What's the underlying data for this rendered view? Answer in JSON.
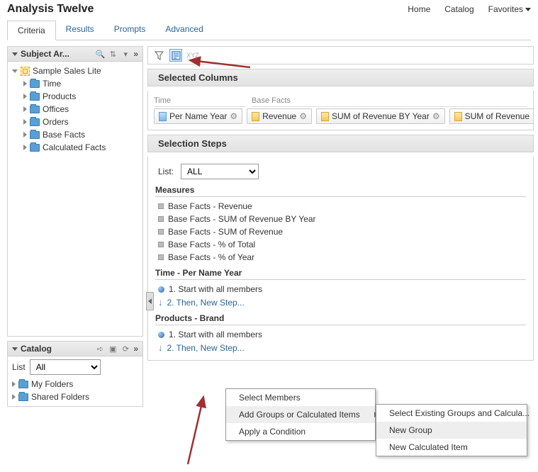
{
  "header": {
    "title": "Analysis Twelve"
  },
  "topnav": {
    "home": "Home",
    "catalog": "Catalog",
    "favorites": "Favorites"
  },
  "tabs": {
    "criteria": "Criteria",
    "results": "Results",
    "prompts": "Prompts",
    "advanced": "Advanced"
  },
  "subject_panel": {
    "title": "Subject Ar...",
    "root": "Sample Sales Lite",
    "items": [
      "Time",
      "Products",
      "Offices",
      "Orders",
      "Base Facts",
      "Calculated Facts"
    ]
  },
  "catalog_panel": {
    "title": "Catalog",
    "list_label": "List",
    "list_value": "All",
    "folders": [
      "My Folders",
      "Shared Folders"
    ]
  },
  "selected_columns": {
    "title": "Selected Columns",
    "group1": "Time",
    "group2": "Base Facts",
    "pill1": "Per Name Year",
    "pill2": "Revenue",
    "pill3": "SUM of Revenue BY Year",
    "pill4": "SUM of Revenue"
  },
  "selection_steps": {
    "title": "Selection Steps",
    "list_label": "List:",
    "list_value": "ALL",
    "measures_label": "Measures",
    "measures": [
      "Base Facts - Revenue",
      "Base Facts - SUM of Revenue BY Year",
      "Base Facts - SUM of Revenue",
      "Base Facts - % of Total",
      "Base Facts - % of Year"
    ],
    "time_label": "Time - Per Name Year",
    "time_step1": "1. Start with all members",
    "then_new_step": "2. Then, New Step...",
    "products_label": "Products - Brand",
    "prod_step1": "1. Start with all members"
  },
  "menu1": {
    "select_members": "Select Members",
    "add_groups": "Add Groups or Calculated Items",
    "apply_condition": "Apply a Condition"
  },
  "menu2": {
    "select_existing": "Select Existing Groups and Calcula...",
    "new_group": "New Group",
    "new_calc": "New Calculated Item"
  }
}
